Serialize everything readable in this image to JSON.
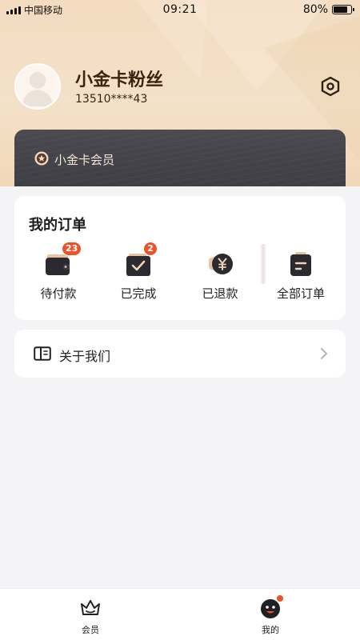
{
  "status_bar": {
    "carrier": "中国移动",
    "time": "09:21",
    "battery_percent": "80%",
    "battery_level": 0.8
  },
  "profile": {
    "username": "小金卡粉丝",
    "phone": "13510****43"
  },
  "member_card": {
    "label": "小金卡会员"
  },
  "orders": {
    "title": "我的订单",
    "items": [
      {
        "label": "待付款",
        "badge": "23",
        "icon": "wallet-icon"
      },
      {
        "label": "已完成",
        "badge": "2",
        "icon": "completed-check-icon"
      },
      {
        "label": "已退款",
        "badge": "",
        "icon": "yuan-coin-icon"
      },
      {
        "label": "全部订单",
        "badge": "",
        "icon": "clipboard-icon"
      }
    ]
  },
  "about": {
    "label": "关于我们",
    "icon": "book-icon"
  },
  "tabbar": {
    "tabs": [
      {
        "label": "会员",
        "icon": "crown-icon"
      },
      {
        "label": "我的",
        "icon": "face-icon"
      }
    ]
  },
  "colors": {
    "accent": "#e9542b",
    "hero_gold": "#f3dcc0",
    "card_dark": "#3d3d44",
    "brown_text": "#3b2414"
  }
}
